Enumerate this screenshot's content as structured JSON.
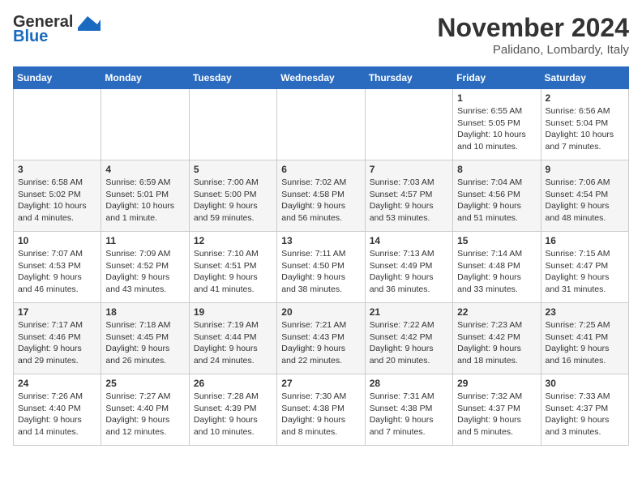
{
  "header": {
    "logo_line1": "General",
    "logo_line2": "Blue",
    "month": "November 2024",
    "location": "Palidano, Lombardy, Italy"
  },
  "weekdays": [
    "Sunday",
    "Monday",
    "Tuesday",
    "Wednesday",
    "Thursday",
    "Friday",
    "Saturday"
  ],
  "weeks": [
    [
      {
        "day": "",
        "text": ""
      },
      {
        "day": "",
        "text": ""
      },
      {
        "day": "",
        "text": ""
      },
      {
        "day": "",
        "text": ""
      },
      {
        "day": "",
        "text": ""
      },
      {
        "day": "1",
        "text": "Sunrise: 6:55 AM\nSunset: 5:05 PM\nDaylight: 10 hours and 10 minutes."
      },
      {
        "day": "2",
        "text": "Sunrise: 6:56 AM\nSunset: 5:04 PM\nDaylight: 10 hours and 7 minutes."
      }
    ],
    [
      {
        "day": "3",
        "text": "Sunrise: 6:58 AM\nSunset: 5:02 PM\nDaylight: 10 hours and 4 minutes."
      },
      {
        "day": "4",
        "text": "Sunrise: 6:59 AM\nSunset: 5:01 PM\nDaylight: 10 hours and 1 minute."
      },
      {
        "day": "5",
        "text": "Sunrise: 7:00 AM\nSunset: 5:00 PM\nDaylight: 9 hours and 59 minutes."
      },
      {
        "day": "6",
        "text": "Sunrise: 7:02 AM\nSunset: 4:58 PM\nDaylight: 9 hours and 56 minutes."
      },
      {
        "day": "7",
        "text": "Sunrise: 7:03 AM\nSunset: 4:57 PM\nDaylight: 9 hours and 53 minutes."
      },
      {
        "day": "8",
        "text": "Sunrise: 7:04 AM\nSunset: 4:56 PM\nDaylight: 9 hours and 51 minutes."
      },
      {
        "day": "9",
        "text": "Sunrise: 7:06 AM\nSunset: 4:54 PM\nDaylight: 9 hours and 48 minutes."
      }
    ],
    [
      {
        "day": "10",
        "text": "Sunrise: 7:07 AM\nSunset: 4:53 PM\nDaylight: 9 hours and 46 minutes."
      },
      {
        "day": "11",
        "text": "Sunrise: 7:09 AM\nSunset: 4:52 PM\nDaylight: 9 hours and 43 minutes."
      },
      {
        "day": "12",
        "text": "Sunrise: 7:10 AM\nSunset: 4:51 PM\nDaylight: 9 hours and 41 minutes."
      },
      {
        "day": "13",
        "text": "Sunrise: 7:11 AM\nSunset: 4:50 PM\nDaylight: 9 hours and 38 minutes."
      },
      {
        "day": "14",
        "text": "Sunrise: 7:13 AM\nSunset: 4:49 PM\nDaylight: 9 hours and 36 minutes."
      },
      {
        "day": "15",
        "text": "Sunrise: 7:14 AM\nSunset: 4:48 PM\nDaylight: 9 hours and 33 minutes."
      },
      {
        "day": "16",
        "text": "Sunrise: 7:15 AM\nSunset: 4:47 PM\nDaylight: 9 hours and 31 minutes."
      }
    ],
    [
      {
        "day": "17",
        "text": "Sunrise: 7:17 AM\nSunset: 4:46 PM\nDaylight: 9 hours and 29 minutes."
      },
      {
        "day": "18",
        "text": "Sunrise: 7:18 AM\nSunset: 4:45 PM\nDaylight: 9 hours and 26 minutes."
      },
      {
        "day": "19",
        "text": "Sunrise: 7:19 AM\nSunset: 4:44 PM\nDaylight: 9 hours and 24 minutes."
      },
      {
        "day": "20",
        "text": "Sunrise: 7:21 AM\nSunset: 4:43 PM\nDaylight: 9 hours and 22 minutes."
      },
      {
        "day": "21",
        "text": "Sunrise: 7:22 AM\nSunset: 4:42 PM\nDaylight: 9 hours and 20 minutes."
      },
      {
        "day": "22",
        "text": "Sunrise: 7:23 AM\nSunset: 4:42 PM\nDaylight: 9 hours and 18 minutes."
      },
      {
        "day": "23",
        "text": "Sunrise: 7:25 AM\nSunset: 4:41 PM\nDaylight: 9 hours and 16 minutes."
      }
    ],
    [
      {
        "day": "24",
        "text": "Sunrise: 7:26 AM\nSunset: 4:40 PM\nDaylight: 9 hours and 14 minutes."
      },
      {
        "day": "25",
        "text": "Sunrise: 7:27 AM\nSunset: 4:40 PM\nDaylight: 9 hours and 12 minutes."
      },
      {
        "day": "26",
        "text": "Sunrise: 7:28 AM\nSunset: 4:39 PM\nDaylight: 9 hours and 10 minutes."
      },
      {
        "day": "27",
        "text": "Sunrise: 7:30 AM\nSunset: 4:38 PM\nDaylight: 9 hours and 8 minutes."
      },
      {
        "day": "28",
        "text": "Sunrise: 7:31 AM\nSunset: 4:38 PM\nDaylight: 9 hours and 7 minutes."
      },
      {
        "day": "29",
        "text": "Sunrise: 7:32 AM\nSunset: 4:37 PM\nDaylight: 9 hours and 5 minutes."
      },
      {
        "day": "30",
        "text": "Sunrise: 7:33 AM\nSunset: 4:37 PM\nDaylight: 9 hours and 3 minutes."
      }
    ]
  ]
}
